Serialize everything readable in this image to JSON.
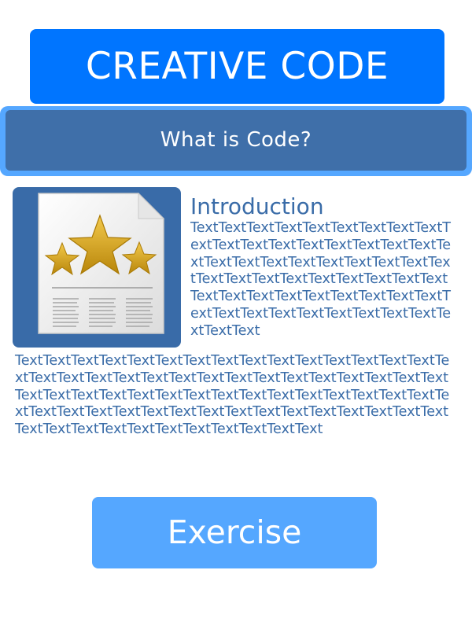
{
  "header": {
    "title": "CREATIVE CODE"
  },
  "nav": {
    "label": "What is Code?"
  },
  "intro": {
    "heading": "Introduction",
    "side_text": "TextTextTextTextTextTextTextTextTextTextTextTextTextTextTextTextTextTextTextTextTextTextTextTextTextTextTextTextTextTextTextTextTextTextTextTextTextTextTextTextTextTextTextTextTextTextTextTextTextTextTextTextTextTextTextTextTextText",
    "body_text": "TextTextTextTextTextTextTextTextTextTextTextTextTextTextTextTextTextTextTextTextTextTextTextTextTextTextTextTextTextTextTextTextTextTextTextTextTextTextTextTextTextTextTextTextTextTextTextTextTextTextTextTextTextTextTextTextTextTextTextTextTextTextTextTextTextTextTextTextTextTextTextTextText"
  },
  "image": {
    "icon": "document-stars-icon",
    "colors": {
      "frame": "#396ba8",
      "star": "#d4a017"
    }
  },
  "exercise": {
    "label": "Exercise"
  },
  "colors": {
    "primary": "#0075ff",
    "nav_outer": "#55a7ff",
    "nav_inner": "#3f6fa9",
    "text": "#3a6ca8",
    "exercise": "#55a7ff"
  }
}
